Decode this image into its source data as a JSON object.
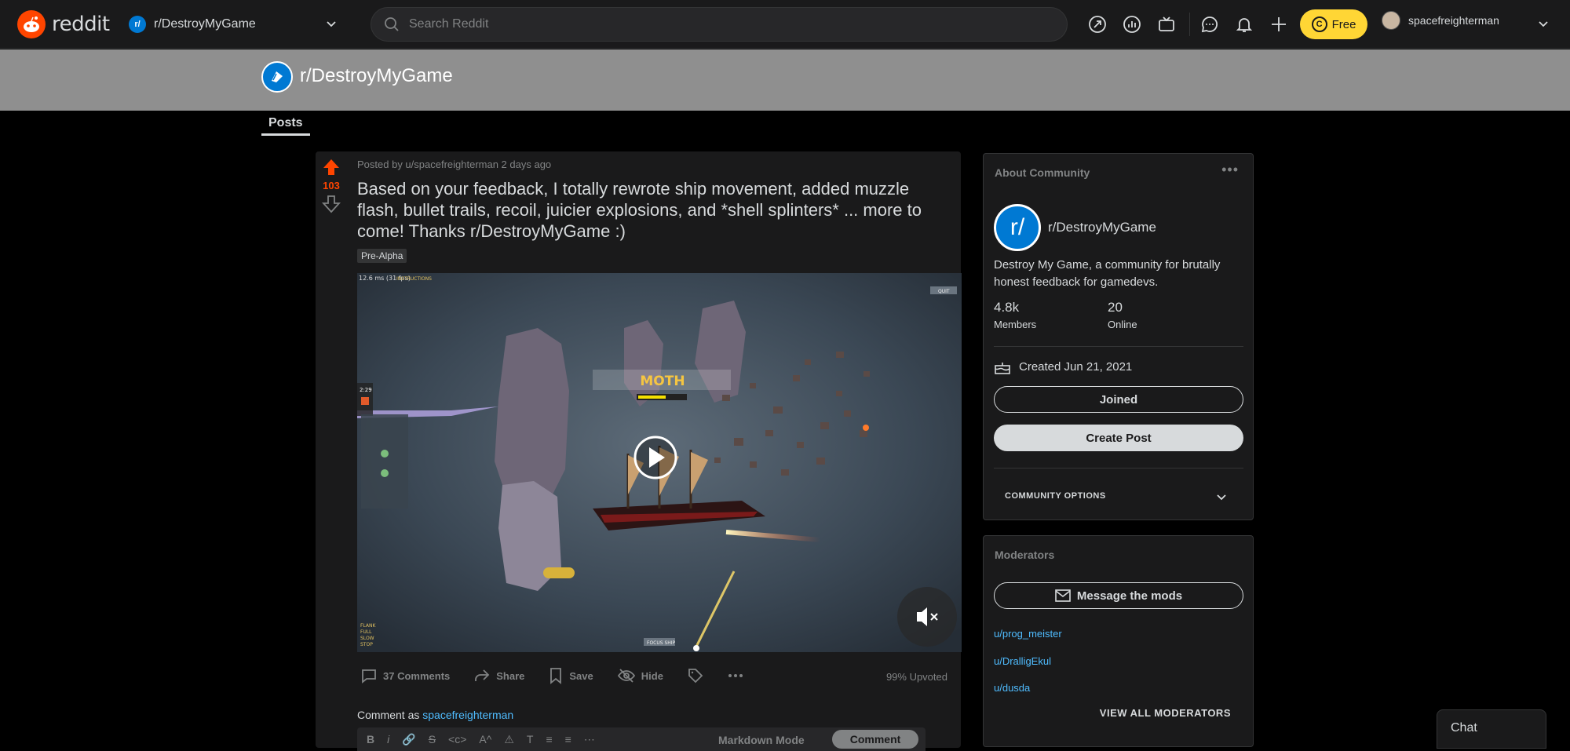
{
  "header": {
    "logo_text": "reddit",
    "subreddit_selector": "r/DestroyMyGame",
    "search_placeholder": "Search Reddit",
    "free_label": "Free",
    "username": "spacefreighterman"
  },
  "banner": {
    "title": "r/DestroyMyGame"
  },
  "tabs": {
    "posts": "Posts"
  },
  "post": {
    "votes": "103",
    "meta": "Posted by u/spacefreighterman 2 days ago",
    "title": "Based on your feedback, I totally rewrote ship movement, added muzzle flash, bullet trails, recoil, juicier explosions, and *shell splinters* ... more to come! Thanks r/DestroyMyGame :)",
    "flair": "Pre-Alpha",
    "video": {
      "fps": "12.6 ms (31 fps)",
      "instructions": "INSTRUCTIONS",
      "quit": "QUIT",
      "timer": "2:29",
      "enemy_name": "MOTH",
      "focus": "FOCUS SHIP",
      "speed_lines": [
        "FLANK",
        "FULL",
        "SLOW",
        "STOP"
      ]
    },
    "actions": {
      "comments": "37 Comments",
      "share": "Share",
      "save": "Save",
      "hide": "Hide",
      "upvoted": "99% Upvoted"
    },
    "comment_as_prefix": "Comment as",
    "comment_as_user": "spacefreighterman",
    "markdown_mode": "Markdown Mode",
    "comment_button": "Comment"
  },
  "about": {
    "heading": "About Community",
    "name": "r/DestroyMyGame",
    "description": "Destroy My Game, a community for brutally honest feedback for gamedevs.",
    "members_value": "4.8k",
    "members_label": "Members",
    "online_value": "20",
    "online_label": "Online",
    "created": "Created Jun 21, 2021",
    "joined_button": "Joined",
    "create_post_button": "Create Post",
    "options": "COMMUNITY OPTIONS"
  },
  "moderators": {
    "heading": "Moderators",
    "message_button": "Message the mods",
    "list": [
      "u/prog_meister",
      "u/DralligEkul",
      "u/dusda"
    ],
    "view_all": "VIEW ALL MODERATORS"
  },
  "chat": {
    "label": "Chat"
  },
  "colors": {
    "accent": "#ff4500",
    "link": "#4fbcff",
    "free": "#ffd635"
  }
}
